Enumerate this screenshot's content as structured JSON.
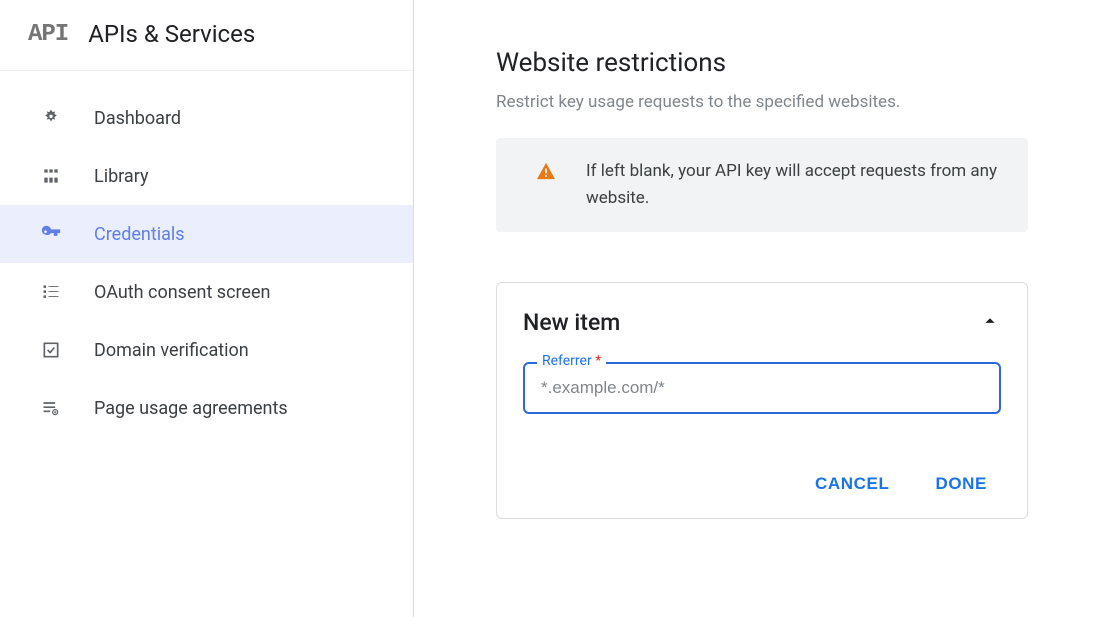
{
  "sidebar": {
    "logo_text": "API",
    "title": "APIs & Services",
    "items": [
      {
        "label": "Dashboard",
        "icon": "dashboard-icon",
        "active": false
      },
      {
        "label": "Library",
        "icon": "library-icon",
        "active": false
      },
      {
        "label": "Credentials",
        "icon": "key-icon",
        "active": true
      },
      {
        "label": "OAuth consent screen",
        "icon": "consent-icon",
        "active": false
      },
      {
        "label": "Domain verification",
        "icon": "check-square-icon",
        "active": false
      },
      {
        "label": "Page usage agreements",
        "icon": "agreements-icon",
        "active": false
      }
    ]
  },
  "main": {
    "section_title": "Website restrictions",
    "section_desc": "Restrict key usage requests to the specified websites.",
    "warning_text": "If left blank, your API key will accept requests from any website.",
    "card": {
      "title": "New item",
      "referrer_label": "Referrer",
      "referrer_required": "*",
      "referrer_placeholder": "*.example.com/*",
      "referrer_value": "",
      "cancel_label": "CANCEL",
      "done_label": "DONE"
    }
  }
}
